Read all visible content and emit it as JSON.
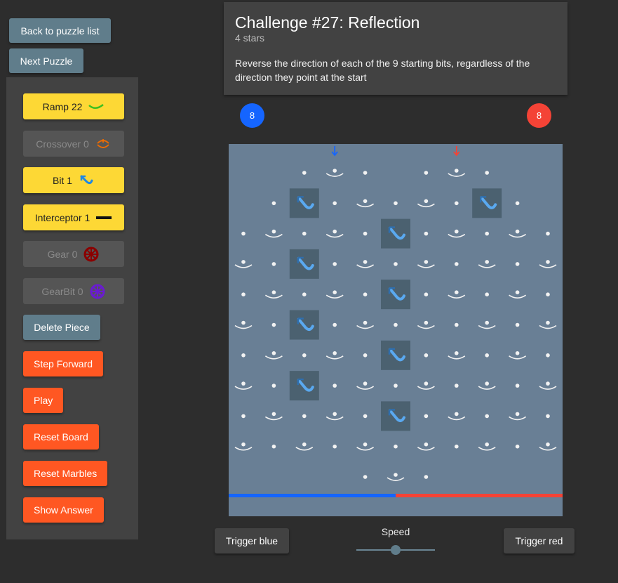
{
  "nav": {
    "back": "Back to puzzle list",
    "next": "Next Puzzle"
  },
  "pieces": [
    {
      "label": "Ramp 22",
      "icon": "ramp-icon",
      "enabled": true
    },
    {
      "label": "Crossover 0",
      "icon": "crossover-icon",
      "enabled": false
    },
    {
      "label": "Bit 1",
      "icon": "bit-icon",
      "enabled": true
    },
    {
      "label": "Interceptor 1",
      "icon": "interceptor-icon",
      "enabled": true
    },
    {
      "label": "Gear 0",
      "icon": "gear-icon",
      "enabled": false
    },
    {
      "label": "GearBit 0",
      "icon": "gearbit-icon",
      "enabled": false
    }
  ],
  "actions": {
    "delete": "Delete Piece",
    "step": "Step Forward",
    "play": "Play",
    "reset_board": "Reset Board",
    "reset_marbles": "Reset Marbles",
    "show_answer": "Show Answer"
  },
  "challenge": {
    "title": "Challenge #27: Reflection",
    "stars": "4 stars",
    "description": "Reverse the direction of each of the 9 starting bits, regardless of the direction they point at the start"
  },
  "marbles": {
    "blue_count": "8",
    "red_count": "8"
  },
  "controls": {
    "trigger_blue": "Trigger blue",
    "speed_label": "Speed",
    "trigger_red": "Trigger red",
    "speed_value": 0.5
  },
  "colors": {
    "blue": "#1565ff",
    "red": "#f44336",
    "piece_yellow": "#fdd835",
    "action_orange": "#ff5722",
    "nav_slate": "#607d8b",
    "board": "#697f95"
  }
}
